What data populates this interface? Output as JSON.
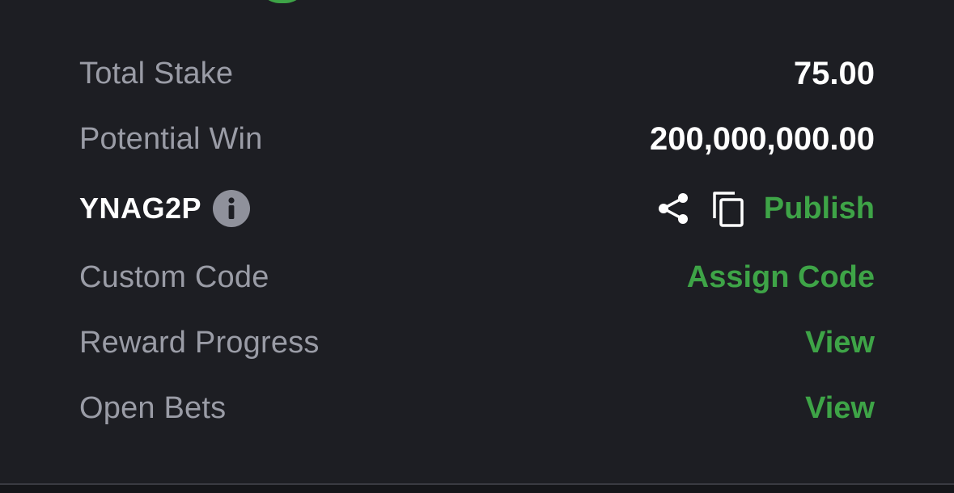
{
  "summary": {
    "total_stake": {
      "label": "Total Stake",
      "value": "75.00"
    },
    "potential_win": {
      "label": "Potential Win",
      "value": "200,000,000.00"
    },
    "booking": {
      "code": "YNAG2P",
      "info_icon": "info-icon",
      "share_icon": "share-icon",
      "copy_icon": "copy-icon",
      "publish_label": "Publish"
    },
    "custom_code": {
      "label": "Custom Code",
      "action_label": "Assign Code"
    },
    "reward_progress": {
      "label": "Reward Progress",
      "action_label": "View"
    },
    "open_bets": {
      "label": "Open Bets",
      "action_label": "View"
    }
  },
  "colors": {
    "background": "#1d1e23",
    "accent_green": "#3ea447",
    "label_gray": "#9a9ca6",
    "value_white": "#ffffff",
    "info_icon_gray": "#8f919b"
  }
}
